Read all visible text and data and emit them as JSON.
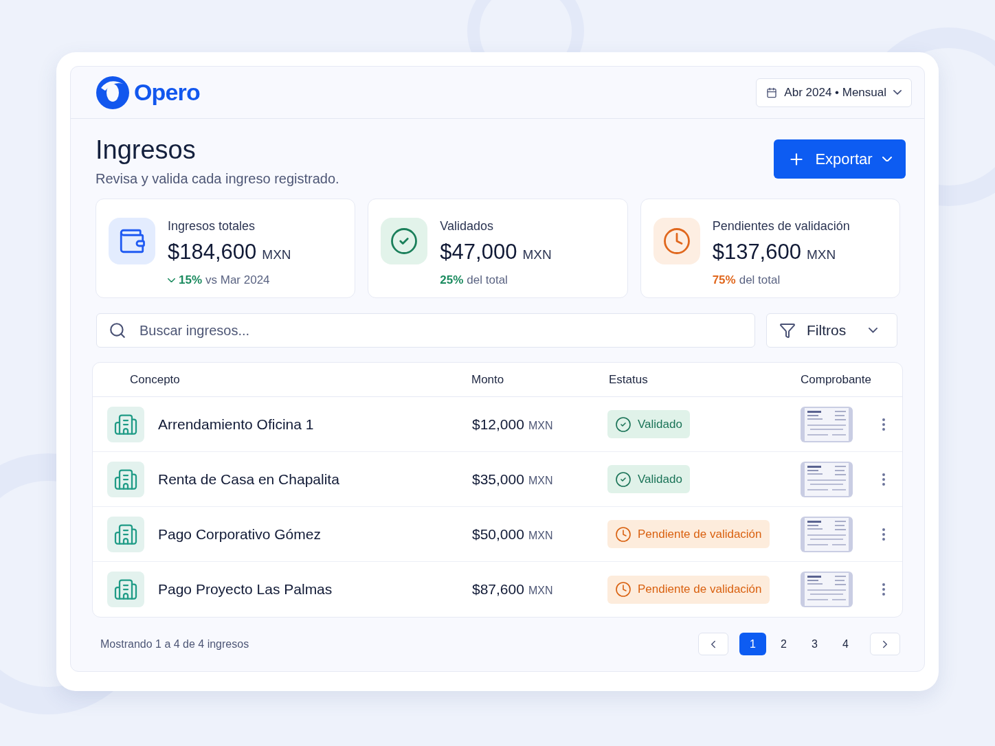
{
  "brand": {
    "name": "Opero"
  },
  "period": {
    "label": "Abr 2024 • Mensual"
  },
  "page": {
    "title": "Ingresos",
    "subtitle": "Revisa y valida cada ingreso registrado.",
    "export_button": "Exportar"
  },
  "stats": [
    {
      "kind": "wallet",
      "label": "Ingresos totales",
      "amount": "$184,600",
      "currency": "MXN",
      "highlight": "15%",
      "note": "vs Mar 2024",
      "decreased": true
    },
    {
      "kind": "validated",
      "label": "Validados",
      "amount": "$47,000",
      "currency": "MXN",
      "highlight": "25%",
      "note": "del total"
    },
    {
      "kind": "pending",
      "label": "Pendientes de validación",
      "amount": "$137,600",
      "currency": "MXN",
      "highlight": "75%",
      "note": "del total"
    }
  ],
  "search": {
    "placeholder": "Buscar ingresos..."
  },
  "filters": {
    "label": "Filtros"
  },
  "table": {
    "columns": [
      "Concepto",
      "Monto",
      "Estatus",
      "Comprobante"
    ],
    "rows": [
      {
        "concept": "Arrendamiento Oficina 1",
        "amount": "$12,000",
        "currency": "MXN",
        "status": "Validado",
        "kind": "validated"
      },
      {
        "concept": "Renta de Casa en Chapalita",
        "amount": "$35,000",
        "currency": "MXN",
        "status": "Validado",
        "kind": "validated"
      },
      {
        "concept": "Pago Corporativo Gómez",
        "amount": "$50,000",
        "currency": "MXN",
        "status": "Pendiente de validación",
        "kind": "pending"
      },
      {
        "concept": "Pago Proyecto Las Palmas",
        "amount": "$87,600",
        "currency": "MXN",
        "status": "Pendiente de validación",
        "kind": "pending"
      }
    ]
  },
  "footer": {
    "summary": "Mostrando 1 a 4 de 4 ingresos",
    "pages": [
      {
        "label": "1",
        "selected": true
      },
      {
        "label": "2",
        "selected": false
      },
      {
        "label": "3",
        "selected": false
      },
      {
        "label": "4",
        "selected": false
      }
    ]
  }
}
